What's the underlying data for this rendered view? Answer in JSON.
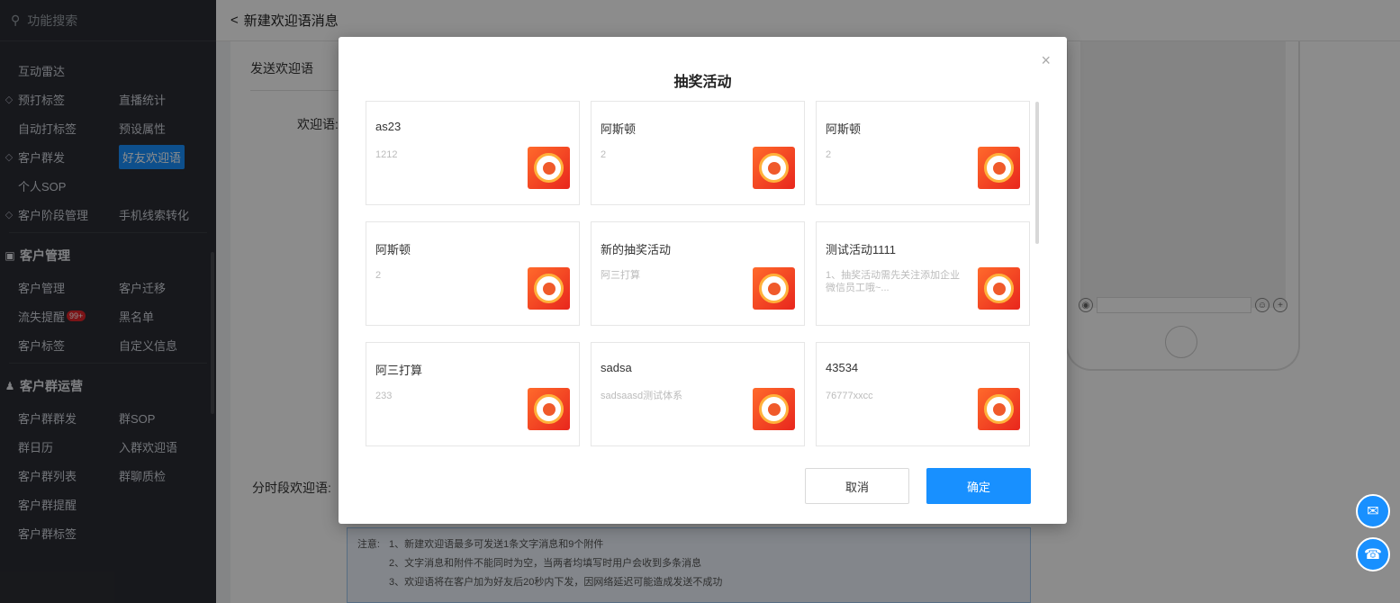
{
  "sidebar": {
    "search": "功能搜索",
    "rows": [
      {
        "c1": "互动雷达",
        "c1_icon": "",
        "c2": ""
      },
      {
        "c1": "预打标签",
        "c1_icon": "tag-icon",
        "c2": "直播统计"
      },
      {
        "c1": "自动打标签",
        "c1_icon": "",
        "c2": "预设属性"
      },
      {
        "c1": "客户群发",
        "c1_icon": "broadcast-icon",
        "c2": "好友欢迎语"
      },
      {
        "c1": "个人SOP",
        "c1_icon": "",
        "c2": ""
      },
      {
        "c1": "客户阶段管理",
        "c1_icon": "stage-icon",
        "c2": "手机线索转化"
      }
    ],
    "section1": "客户管理",
    "rows2": [
      {
        "c1": "客户管理",
        "c2": "客户迁移"
      },
      {
        "c1": "流失提醒",
        "badge": "99+",
        "c2": "黑名单"
      },
      {
        "c1": "客户标签",
        "c2": "自定义信息"
      }
    ],
    "section2": "客户群运营",
    "rows3": [
      {
        "c1": "客户群群发",
        "c2": "群SOP"
      },
      {
        "c1": "群日历",
        "c2": "入群欢迎语"
      },
      {
        "c1": "客户群列表",
        "c2": "群聊质检"
      },
      {
        "c1": "客户群提醒",
        "c2": ""
      },
      {
        "c1": "客户群标签",
        "c2": ""
      }
    ]
  },
  "topbar": {
    "back": "<",
    "title": "新建欢迎语消息"
  },
  "form": {
    "tab": "发送欢迎语",
    "welcome_label": "欢迎语:",
    "period_label": "分时段欢迎语:"
  },
  "notice": {
    "label": "注意:",
    "lines": [
      "1、新建欢迎语最多可发送1条文字消息和9个附件",
      "2、文字消息和附件不能同时为空，当两者均填写时用户会收到多条消息",
      "3、欢迎语将在客户加为好友后20秒内下发，因网络延迟可能造成发送不成功"
    ]
  },
  "modal": {
    "title": "抽奖活动",
    "close": "×",
    "cards": [
      {
        "title": "as23",
        "desc": "1212"
      },
      {
        "title": "阿斯顿",
        "desc": "2"
      },
      {
        "title": "阿斯顿",
        "desc": "2"
      },
      {
        "title": "阿斯顿",
        "desc": "2"
      },
      {
        "title": "新的抽奖活动",
        "desc": "阿三打算"
      },
      {
        "title": "测试活动1111",
        "desc": "1、抽奖活动需先关注添加企业微信员工哦~..."
      },
      {
        "title": "阿三打算",
        "desc": "233"
      },
      {
        "title": "sadsa",
        "desc": "sadsaasd测试体系"
      },
      {
        "title": "43534",
        "desc": "76777xxcc"
      }
    ],
    "cancel": "取消",
    "ok": "确定"
  },
  "colors": {
    "primary": "#1890ff",
    "sidebar_bg": "#2b2d33"
  }
}
